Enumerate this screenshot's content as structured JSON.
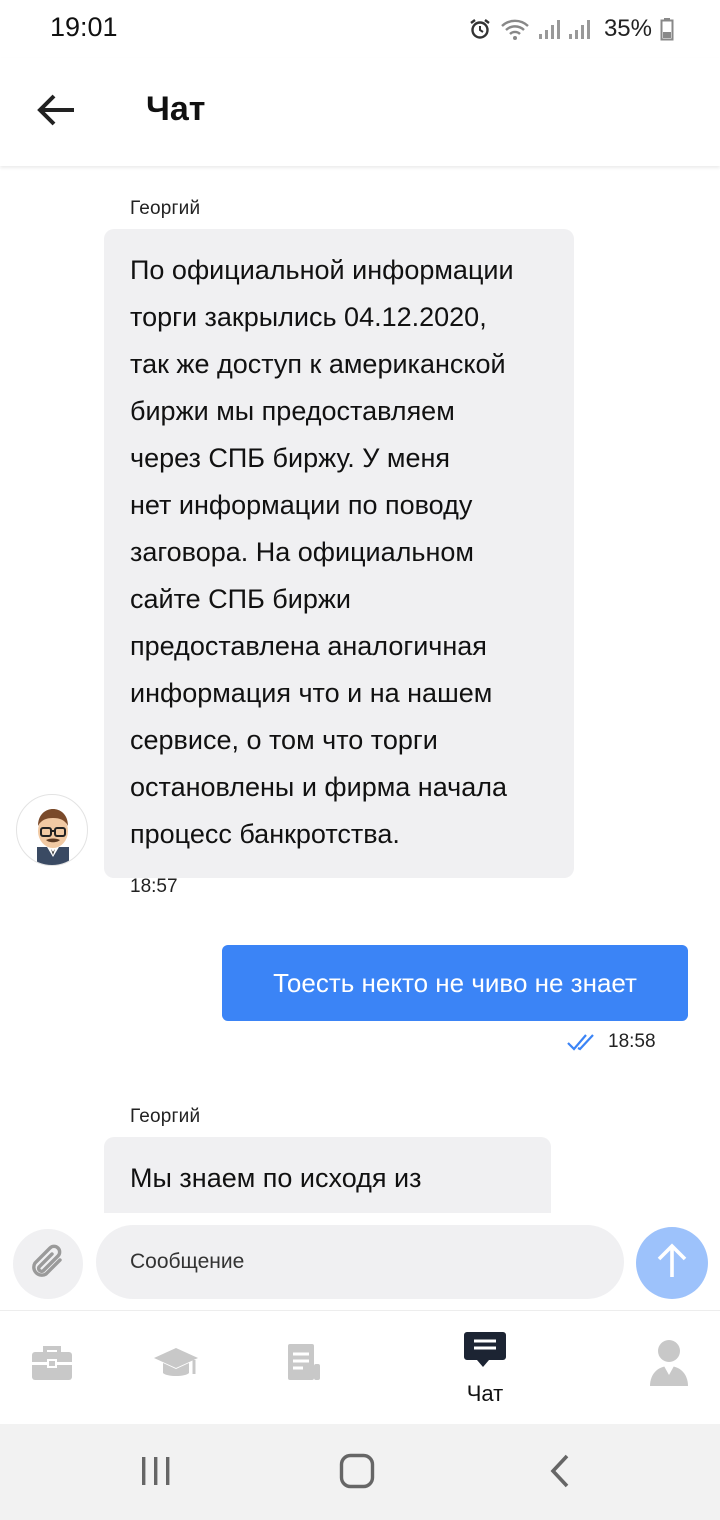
{
  "status_bar": {
    "time": "19:01",
    "battery": "35%",
    "icons": [
      "alarm-icon",
      "wifi-icon",
      "signal-icon",
      "signal-icon",
      "battery-icon"
    ]
  },
  "header": {
    "title": "Чат",
    "back_icon": "arrow-left-icon"
  },
  "messages": [
    {
      "direction": "incoming",
      "sender": "Георгий",
      "lines": [
        "По официальной информации",
        "торги закрылись 04.12.2020,",
        "так же доступ к американской",
        "биржи мы предоставляем",
        "через СПБ биржу.  У меня",
        "нет информации по поводу",
        "заговора.  На официальном",
        "сайте СПБ биржи",
        "предоставлена аналогичная",
        "информация что и на нашем",
        "сервисе, о том что торги",
        "остановлены и фирма начала",
        "процесс банкротства."
      ],
      "time": "18:57"
    },
    {
      "direction": "outgoing",
      "text": "Тоесть некто не чиво не знает",
      "time": "18:58",
      "status": "read"
    },
    {
      "direction": "incoming",
      "sender": "Георгий",
      "lines": [
        "Мы знаем по исходя из"
      ]
    }
  ],
  "composer": {
    "placeholder": "Сообщение",
    "attach_icon": "paperclip-icon",
    "send_icon": "arrow-up-icon"
  },
  "tabs": [
    {
      "icon": "briefcase-icon",
      "label": "",
      "active": false
    },
    {
      "icon": "graduation-cap-icon",
      "label": "",
      "active": false
    },
    {
      "icon": "document-icon",
      "label": "",
      "active": false
    },
    {
      "icon": "chat-icon",
      "label": "Чат",
      "active": true
    },
    {
      "icon": "profile-icon",
      "label": "",
      "active": false
    }
  ],
  "colors": {
    "accent": "#3b84f6",
    "send_button": "#9dc2fb",
    "incoming_bubble": "#f0f0f2",
    "inactive_tab": "#c8c8c8"
  }
}
